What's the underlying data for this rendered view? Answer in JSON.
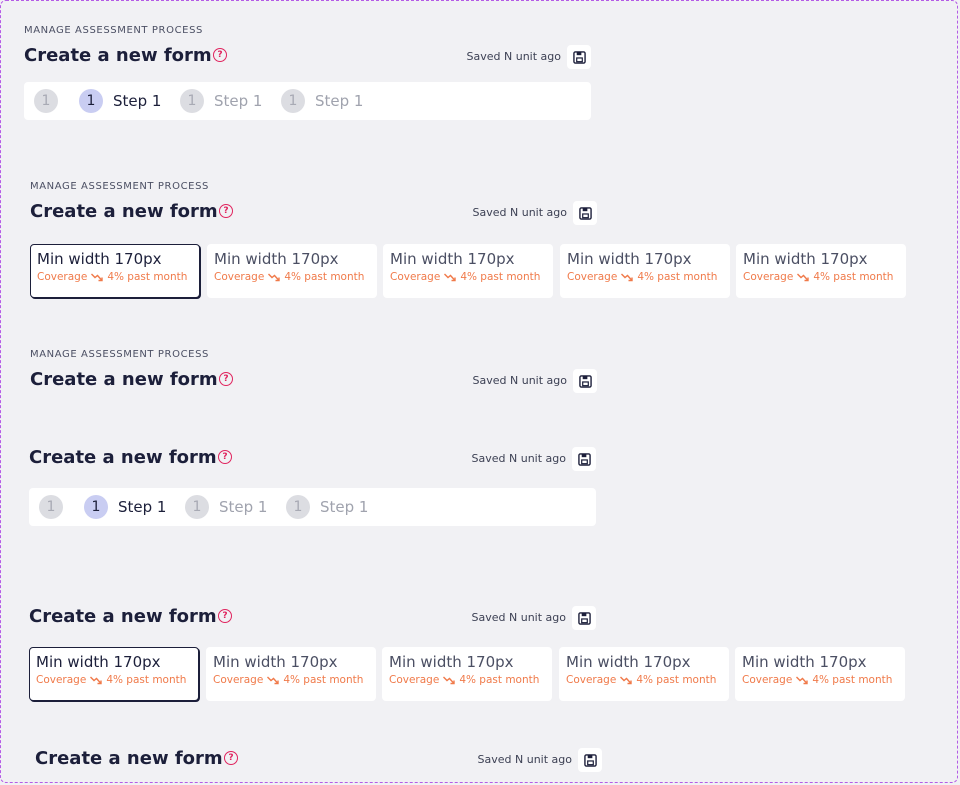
{
  "eyebrow": "MANAGE ASSESSMENT PROCESS",
  "title": "Create a new form",
  "help_glyph": "?",
  "saved_text": "Saved N unit ago",
  "icons": {
    "help": "help-circle-icon",
    "save": "floppy-disk-icon",
    "trend": "trending-down-icon"
  },
  "colors": {
    "accent": "#e0245e",
    "coverage": "#f07a4a",
    "active_step": "#c9cdf2",
    "text": "#1c1f3a"
  },
  "stepper": {
    "steps": [
      {
        "number": "1",
        "label": "",
        "state": "done"
      },
      {
        "number": "1",
        "label": "Step 1",
        "state": "active"
      },
      {
        "number": "1",
        "label": "Step 1",
        "state": "pending"
      },
      {
        "number": "1",
        "label": "Step 1",
        "state": "pending"
      }
    ]
  },
  "cards": [
    {
      "title": "Min width 170px",
      "metric": "Coverage",
      "change": "4% past month",
      "selected": true
    },
    {
      "title": "Min width 170px",
      "metric": "Coverage",
      "change": "4% past month",
      "selected": false
    },
    {
      "title": "Min width 170px",
      "metric": "Coverage",
      "change": "4% past month",
      "selected": false
    },
    {
      "title": "Min width 170px",
      "metric": "Coverage",
      "change": "4% past month",
      "selected": false
    },
    {
      "title": "Min width 170px",
      "metric": "Coverage",
      "change": "4% past month",
      "selected": false
    }
  ]
}
